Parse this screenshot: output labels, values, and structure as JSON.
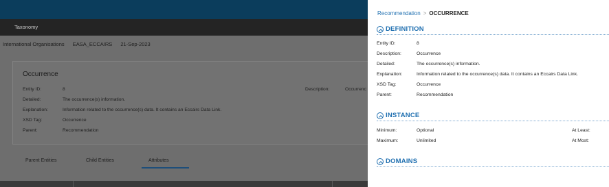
{
  "background": {
    "nav_label": "Taxonomy",
    "breadcrumb": [
      "International Organisations",
      "EASA_ECCAIRS",
      "21-Sep-2023"
    ],
    "card": {
      "title": "Occurrence",
      "entity_id_label": "Entity ID:",
      "entity_id_value": "8",
      "detailed_label": "Detailed:",
      "detailed_value": "The occurrence(s) information.",
      "explanation_label": "Explanation:",
      "explanation_value": "Information related to the occurrence(s) data. It contains an Eccairs Data Link.",
      "xsd_tag_label": "XSD Tag:",
      "xsd_tag_value": "Occurrence",
      "parent_label": "Parent:",
      "parent_value": "Recommendation",
      "description_label": "Description:",
      "description_value": "Occurrenc"
    },
    "tabs": [
      "Parent Entities",
      "Child Entities",
      "Attributes"
    ]
  },
  "panel": {
    "breadcrumb": {
      "link": "Recommendation",
      "separator": ">",
      "current": "OCCURRENCE"
    },
    "definition": {
      "title": "DEFINITION",
      "rows": [
        {
          "label": "Entity ID:",
          "value": "8"
        },
        {
          "label": "Description:",
          "value": "Occurrence"
        },
        {
          "label": "Detailed:",
          "value": "The occurrence(s) information."
        },
        {
          "label": "Explanation:",
          "value": "Information related to the occurrence(s) data. It contains an Eccairs Data Link."
        },
        {
          "label": "XSD Tag:",
          "value": "Occurrence"
        },
        {
          "label": "Parent:",
          "value": "Recommendation"
        }
      ]
    },
    "instance": {
      "title": "INSTANCE",
      "minimum_label": "Minimum:",
      "minimum_value": "Optional",
      "maximum_label": "Maximum:",
      "maximum_value": "Unlimited",
      "at_least_label": "At Least:",
      "at_most_label": "At Most:"
    },
    "domains": {
      "title": "DOMAINS"
    }
  },
  "colors": {
    "accent": "#1f6fb0",
    "topbar": "#0b3d5c",
    "navbar": "#242424"
  }
}
